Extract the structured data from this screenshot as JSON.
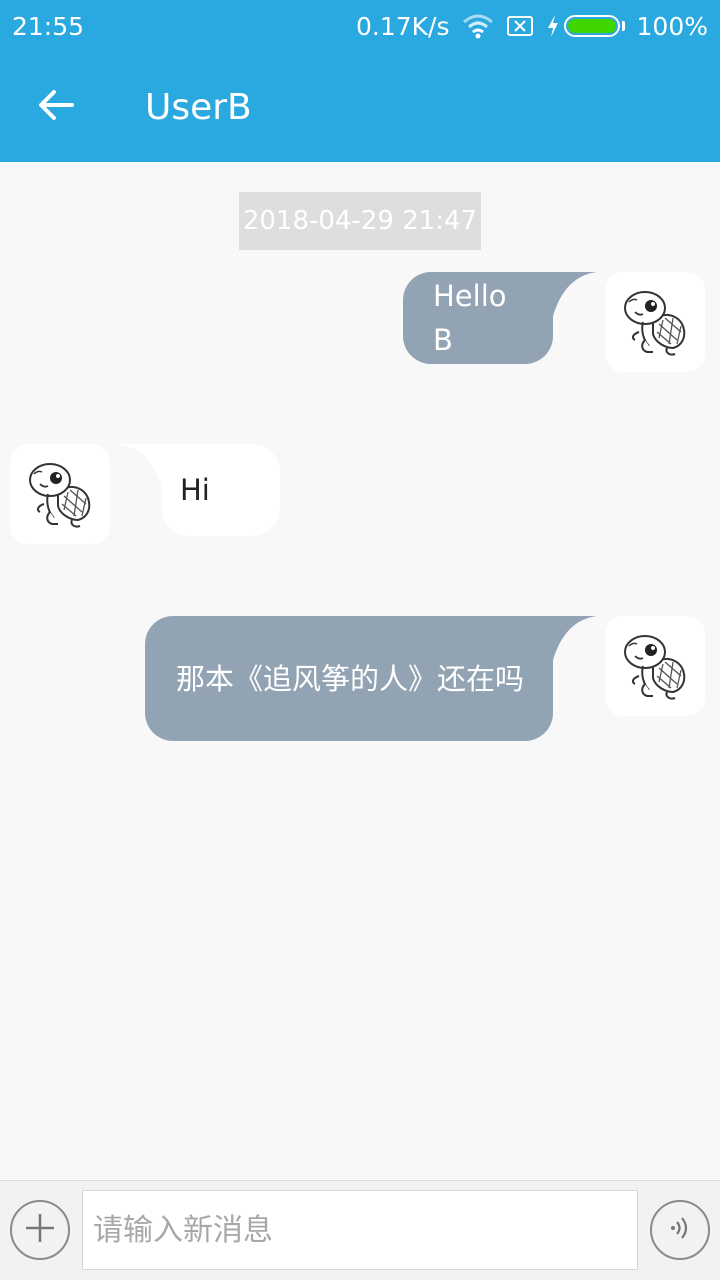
{
  "status_bar": {
    "time": "21:55",
    "net_speed": "0.17K/s",
    "battery_percent": "100%",
    "icons": [
      "wifi-icon",
      "no-sim-icon",
      "charging-icon",
      "battery-icon"
    ]
  },
  "app_bar": {
    "title": "UserB",
    "back_icon": "arrow-left-icon"
  },
  "chat": {
    "timestamp": "2018-04-29 21:47",
    "messages": [
      {
        "direction": "outgoing",
        "text": "Hello B",
        "avatar": "turtle-avatar"
      },
      {
        "direction": "incoming",
        "text": "Hi",
        "avatar": "turtle-avatar"
      },
      {
        "direction": "outgoing",
        "text": "那本《追风筝的人》还在吗",
        "avatar": "turtle-avatar"
      }
    ]
  },
  "input_bar": {
    "placeholder": "请输入新消息",
    "value": "",
    "add_icon": "plus-icon",
    "voice_icon": "voice-icon"
  },
  "colors": {
    "primary": "#2aa9e0",
    "outgoing_bubble": "#92a4b4",
    "incoming_bubble": "#ffffff",
    "background": "#f8f8f8",
    "battery_fill": "#3fd600"
  }
}
